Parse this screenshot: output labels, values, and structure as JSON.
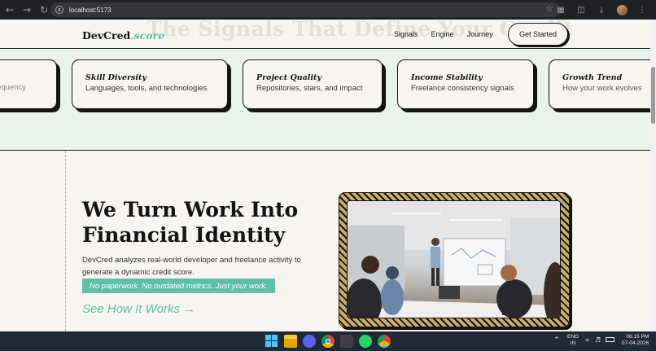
{
  "browser": {
    "url": "localhost:5173",
    "nav_icons": [
      "back-arrow-icon",
      "forward-arrow-icon",
      "reload-icon"
    ]
  },
  "header": {
    "ghost_heading": "The Signals That Define Your Credit",
    "logo_main": "DevCred",
    "logo_accent": ".score",
    "nav": [
      "Signals",
      "Engine",
      "Journey"
    ],
    "cta": "Get Started"
  },
  "signals": {
    "cards": [
      {
        "title": "",
        "desc": "Frequency"
      },
      {
        "title": "Skill Diversity",
        "desc": "Languages, tools, and technologies"
      },
      {
        "title": "Project Quality",
        "desc": "Repositories, stars, and impact"
      },
      {
        "title": "Income Stability",
        "desc": "Freelance consistency signals"
      },
      {
        "title": "Growth Trend",
        "desc": "How your work evolves"
      }
    ]
  },
  "hero": {
    "title_line1": "We Turn Work Into",
    "title_line2": "Financial Identity",
    "description": "DevCred analyzes real-world developer and freelance activity to generate a dynamic credit score.",
    "highlight": "No paperwork. No outdated metrics. Just your work.",
    "link": "See How It Works →"
  },
  "taskbar": {
    "lang_line1": "ENG",
    "lang_line2": "IN",
    "time": "06:15 PM",
    "date": "07-04-2026"
  },
  "colors": {
    "accent": "#5fbfa8",
    "ink": "#141414",
    "page_bg": "#f8f5f0",
    "strip_bg": "#e9f3ec"
  }
}
